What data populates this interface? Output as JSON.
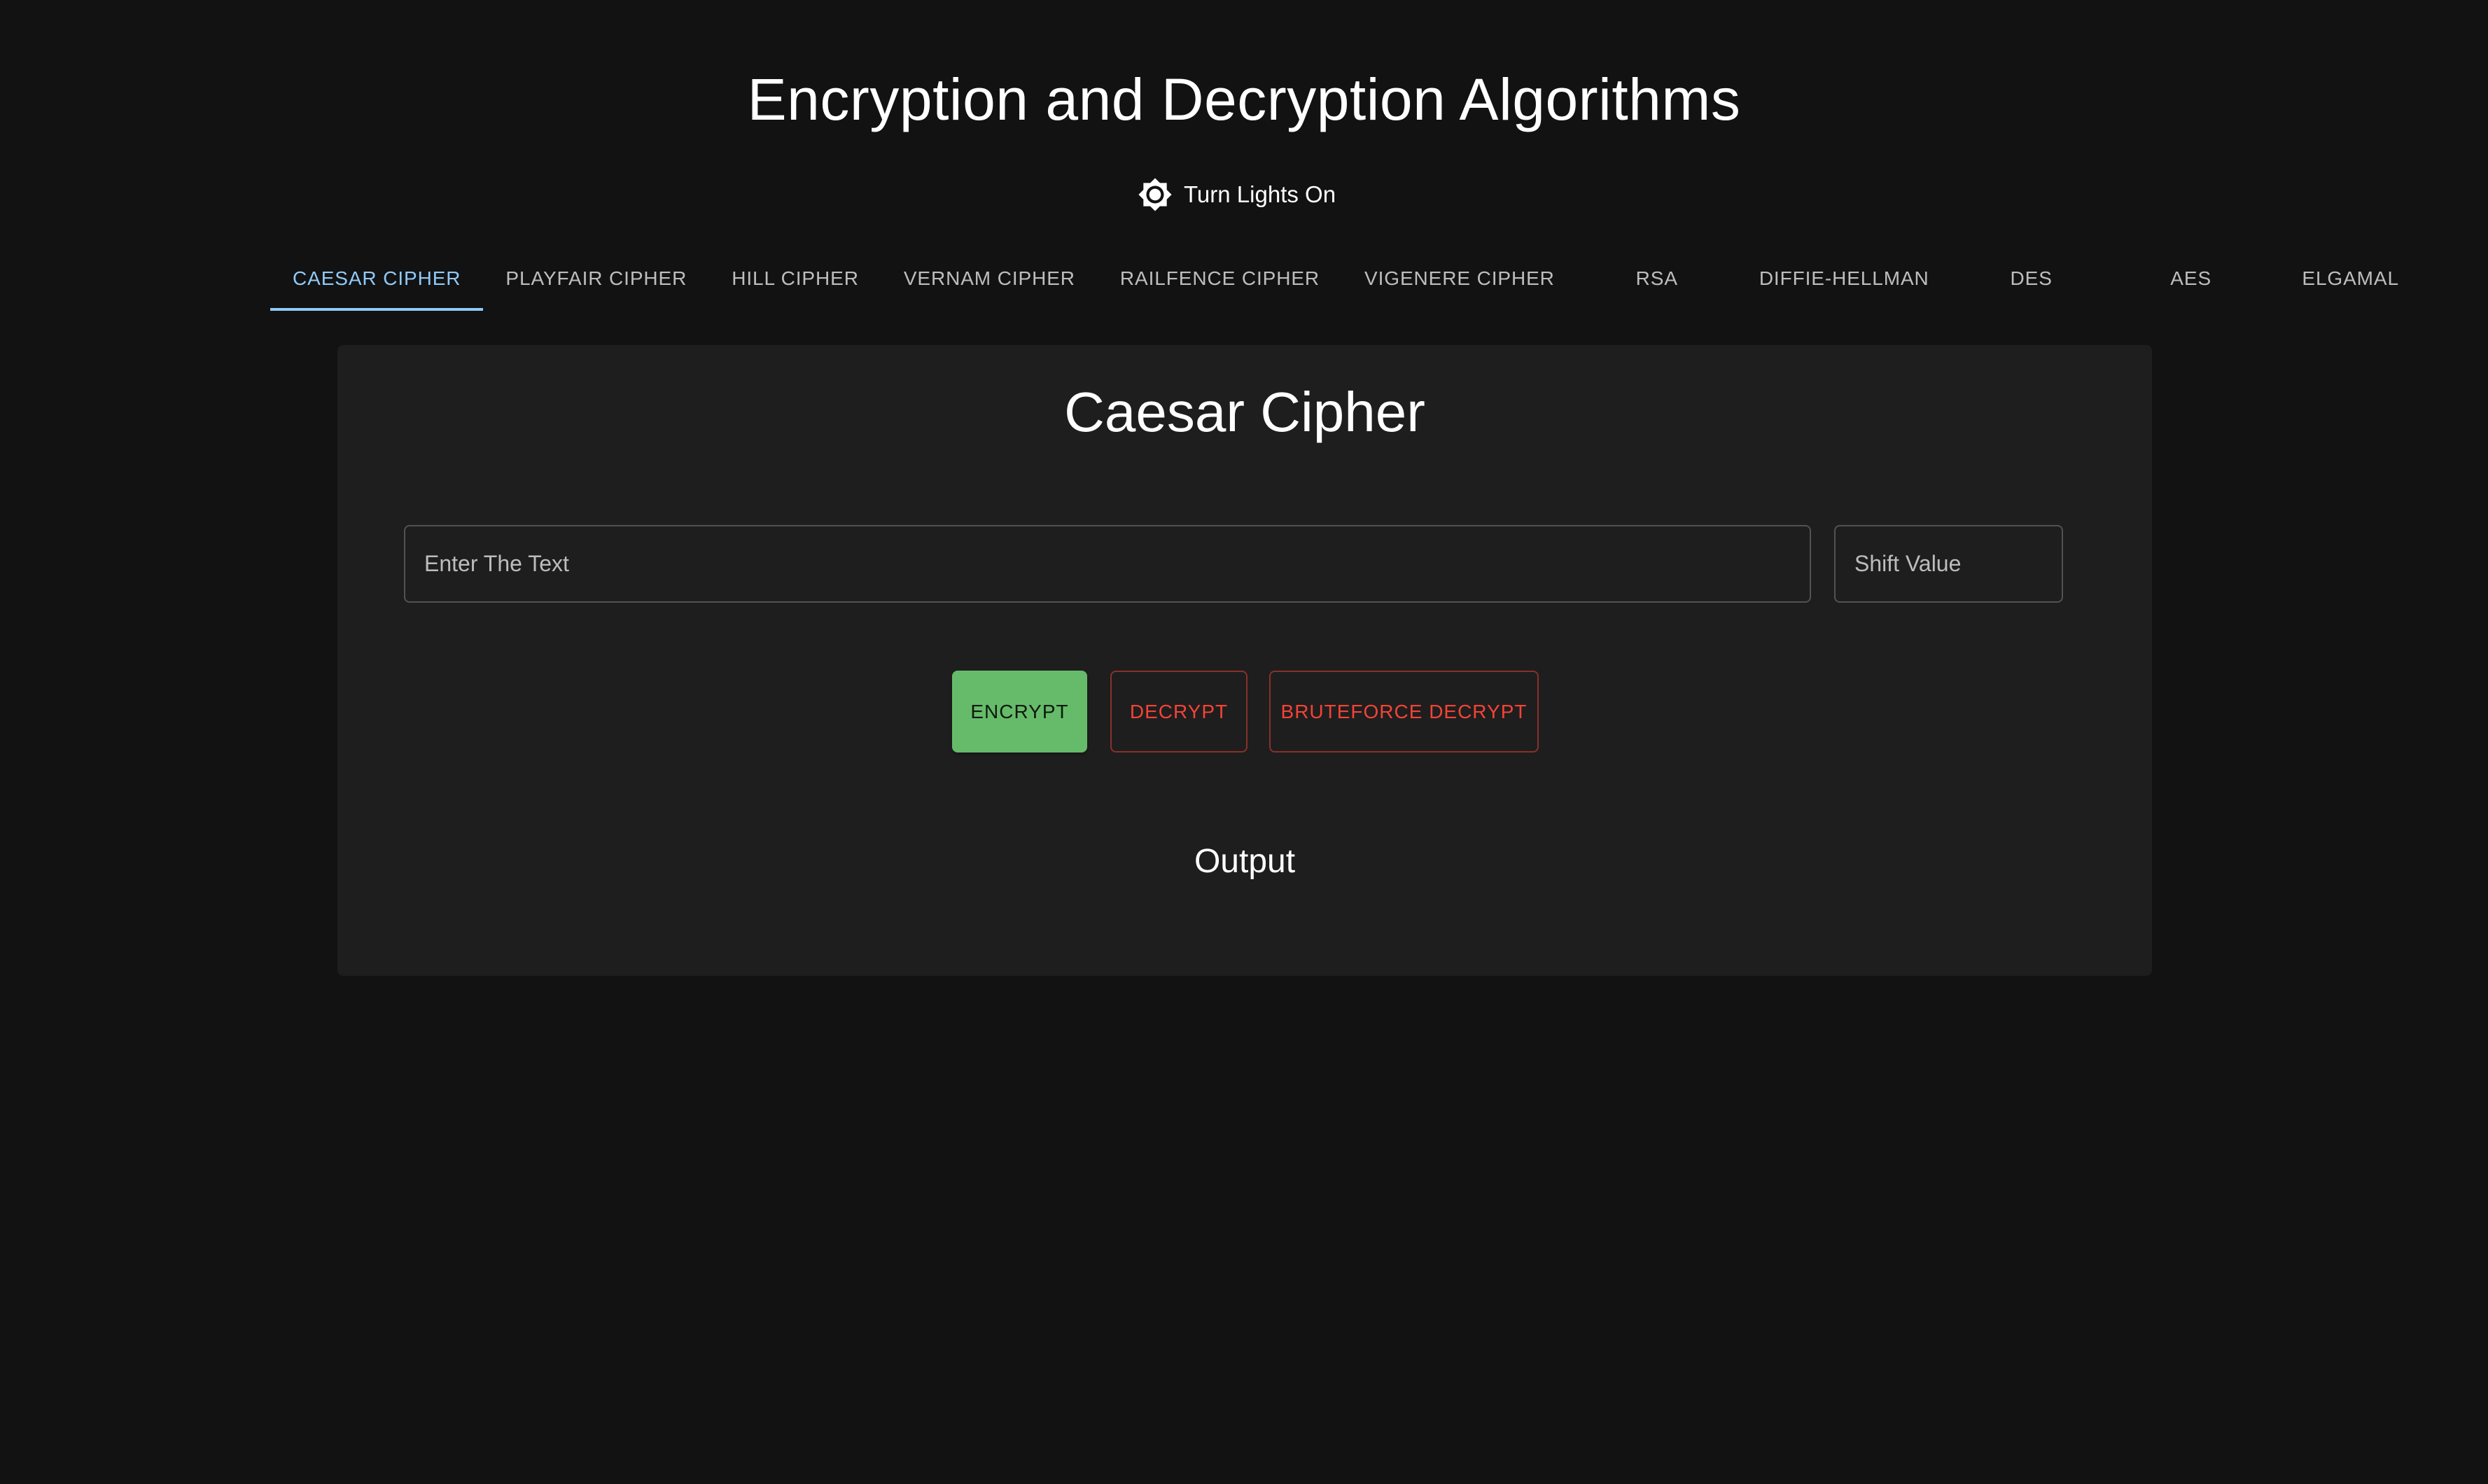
{
  "header": {
    "title": "Encryption and Decryption Algorithms",
    "theme_toggle": {
      "label": "Turn Lights On",
      "icon": "brightness-icon"
    }
  },
  "tabs": [
    {
      "label": "CAESAR CIPHER",
      "active": true
    },
    {
      "label": "PLAYFAIR CIPHER",
      "active": false
    },
    {
      "label": "HILL CIPHER",
      "active": false
    },
    {
      "label": "VERNAM CIPHER",
      "active": false
    },
    {
      "label": "RAILFENCE CIPHER",
      "active": false
    },
    {
      "label": "VIGENERE CIPHER",
      "active": false
    },
    {
      "label": "RSA",
      "active": false
    },
    {
      "label": "DIFFIE-HELLMAN",
      "active": false
    },
    {
      "label": "DES",
      "active": false
    },
    {
      "label": "AES",
      "active": false
    },
    {
      "label": "ELGAMAL",
      "active": false
    }
  ],
  "panel": {
    "title": "Caesar Cipher",
    "text_input": {
      "placeholder": "Enter The Text",
      "value": ""
    },
    "shift_input": {
      "placeholder": "Shift Value",
      "value": ""
    },
    "buttons": {
      "encrypt": "ENCRYPT",
      "decrypt": "DECRYPT",
      "bruteforce": "BRUTEFORCE DECRYPT"
    },
    "output_heading": "Output"
  },
  "colors": {
    "background": "#121212",
    "card": "#1e1e1e",
    "tab_active": "#90caf9",
    "encrypt_button": "#66bb6a",
    "danger": "#f44336"
  }
}
